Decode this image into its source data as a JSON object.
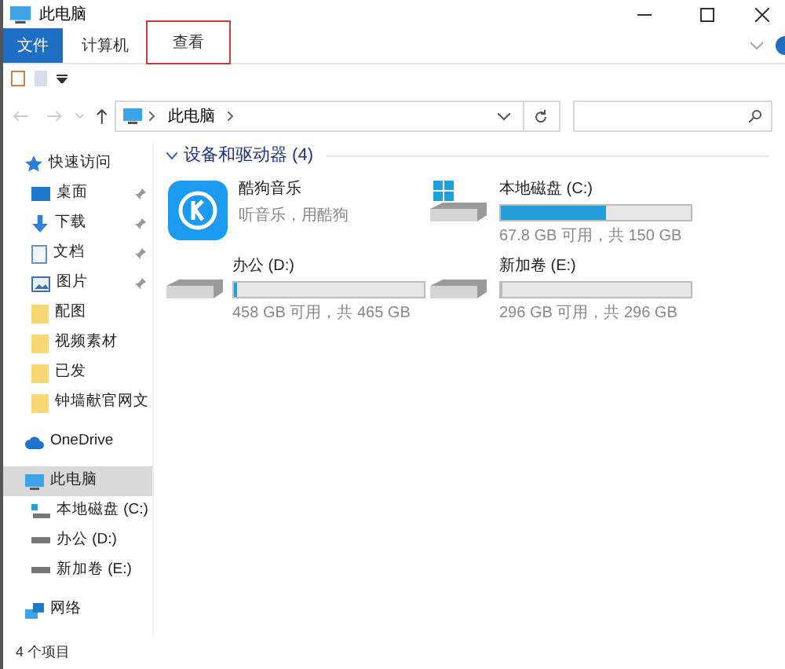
{
  "window": {
    "title": "此电脑"
  },
  "ribbon_tabs": [
    {
      "label": "文件",
      "kind": "file",
      "selected": false,
      "highlighted": false
    },
    {
      "label": "计算机",
      "kind": "tab",
      "selected": false,
      "highlighted": false
    },
    {
      "label": "查看",
      "kind": "tab",
      "selected": false,
      "highlighted": true
    }
  ],
  "address_bar": {
    "path": "此电脑"
  },
  "sidebar": [
    {
      "label": "快速访问",
      "kind": "star",
      "selected": false,
      "children": [
        {
          "label": "桌面",
          "kind": "desktop",
          "pinned": true
        },
        {
          "label": "下载",
          "kind": "download",
          "pinned": true
        },
        {
          "label": "文档",
          "kind": "document",
          "pinned": true
        },
        {
          "label": "图片",
          "kind": "picture",
          "pinned": true
        },
        {
          "label": "配图",
          "kind": "folder",
          "pinned": false
        },
        {
          "label": "视频素材",
          "kind": "folder",
          "pinned": false
        },
        {
          "label": "已发",
          "kind": "folder",
          "pinned": false
        },
        {
          "label": "钟墙献官网文",
          "kind": "folder",
          "pinned": false
        }
      ]
    },
    {
      "label": "OneDrive",
      "kind": "cloud",
      "selected": false
    },
    {
      "label": "此电脑",
      "kind": "pc",
      "selected": true,
      "children": [
        {
          "label": "本地磁盘 (C:)",
          "kind": "sysdrive",
          "pinned": false
        },
        {
          "label": "办公 (D:)",
          "kind": "drive",
          "pinned": false
        },
        {
          "label": "新加卷 (E:)",
          "kind": "drive",
          "pinned": false
        }
      ]
    },
    {
      "label": "网络",
      "kind": "network",
      "selected": false
    }
  ],
  "section": {
    "title": "设备和驱动器 (4)",
    "expanded": true
  },
  "items": [
    {
      "kind": "app",
      "name": "酷狗音乐",
      "subtitle": "听音乐，用酷狗"
    },
    {
      "kind": "sysdrive",
      "name": "本地磁盘 (C:)",
      "level": 0.55,
      "space": "67.8 GB 可用，共 150 GB"
    },
    {
      "kind": "drive",
      "name": "办公 (D:)",
      "level": 0.015,
      "space": "458 GB 可用，共 465 GB"
    },
    {
      "kind": "drive",
      "name": "新加卷 (E:)",
      "level": 0,
      "space": "296 GB 可用，共 296 GB"
    }
  ],
  "status_bar": {
    "text": "4 个项目"
  }
}
